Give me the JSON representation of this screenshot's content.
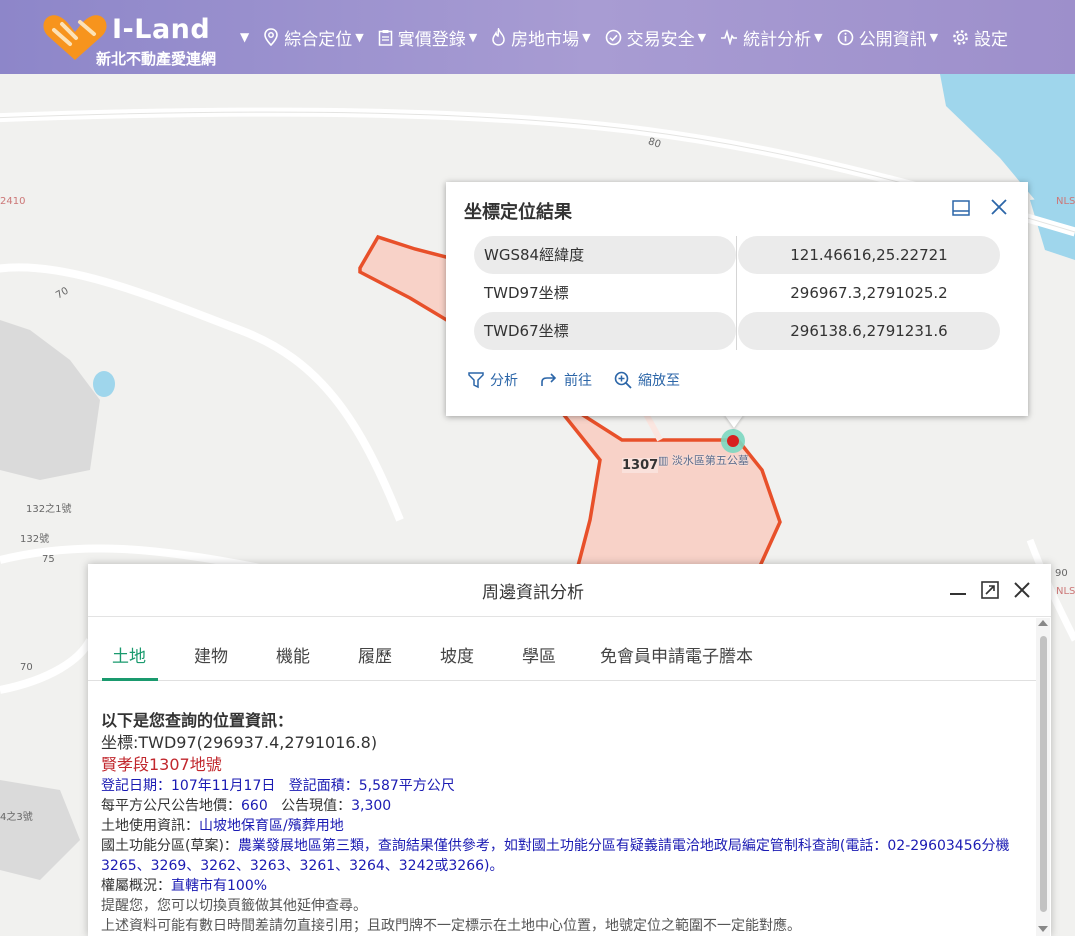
{
  "brand": {
    "title": "I-Land",
    "subtitle": "新北不動產愛連網"
  },
  "nav": {
    "items": [
      {
        "label": "綜合定位",
        "icon": "map-pin-icon"
      },
      {
        "label": "實價登錄",
        "icon": "clipboard-icon"
      },
      {
        "label": "房地市場",
        "icon": "flame-icon"
      },
      {
        "label": "交易安全",
        "icon": "check-circle-icon"
      },
      {
        "label": "統計分析",
        "icon": "pulse-icon"
      },
      {
        "label": "公開資訊",
        "icon": "info-circle-icon"
      },
      {
        "label": "設定",
        "icon": "gear-icon"
      }
    ]
  },
  "map": {
    "labels": {
      "road_80": "80",
      "road_70_a": "70",
      "road_70_b": "70",
      "road_75": "75",
      "road_90": "90",
      "num_2410": "2410",
      "num_132_1": "132之1號",
      "num_132": "132號",
      "num_4_3": "4之3號",
      "nls_a": "NLS",
      "nls_b": "NLS"
    },
    "poi": "淡水區第五公墓",
    "parcel_number": "1307"
  },
  "popup": {
    "title": "坐標定位結果",
    "rows": [
      {
        "key": "WGS84經緯度",
        "value": "121.46616,25.22721"
      },
      {
        "key": "TWD97坐標",
        "value": "296967.3,2791025.2"
      },
      {
        "key": "TWD67坐標",
        "value": "296138.6,2791231.6"
      }
    ],
    "actions": {
      "analyze": "分析",
      "goto": "前往",
      "zoom": "縮放至"
    }
  },
  "panel": {
    "title": "周邊資訊分析",
    "tabs": [
      "土地",
      "建物",
      "機能",
      "履歷",
      "坡度",
      "學區",
      "免會員申請電子謄本"
    ],
    "content": {
      "heading": "以下是您查詢的位置資訊：",
      "coord": "坐標:TWD97(296937.4,2791016.8)",
      "parcel": "賢孝段1307地號",
      "reg_date_label": "登記日期：",
      "reg_date": "107年11月17日",
      "reg_area_label": "登記面積：",
      "reg_area": "5,587平方公尺",
      "price_label": "每平方公尺公告地價：",
      "price": "660",
      "current_label": "公告現值：",
      "current": "3,300",
      "use_label": "土地使用資訊：",
      "use": "山坡地保育區/殯葬用地",
      "zone_label": "國土功能分區(草案)：",
      "zone": "農業發展地區第三類，查詢結果僅供參考，如對國土功能分區有疑義請電洽地政局編定管制科查詢(電話：02-29603456分機3265、3269、3262、3263、3261、3264、3242或3266)。",
      "owner_label": "權屬概況：",
      "owner": "直轄市有100%",
      "note1": "提醒您，您可以切換頁籤做其他延伸查尋。",
      "note2": "上述資料可能有數日時間差請勿直接引用；且政門牌不一定標示在土地中心位置，地號定位之範圍不一定能對應。"
    }
  }
}
